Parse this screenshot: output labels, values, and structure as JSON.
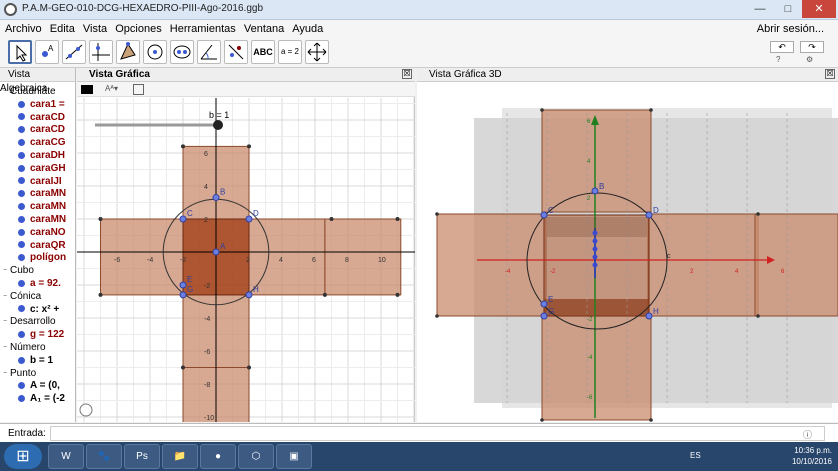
{
  "window": {
    "title": "P.A.M-GEO-010-DCG-HEXAEDRO-PIII-Ago-2016.ggb",
    "min": "—",
    "max": "□",
    "close": "✕"
  },
  "menu": {
    "items": [
      "Archivo",
      "Edita",
      "Vista",
      "Opciones",
      "Herramientas",
      "Ventana",
      "Ayuda"
    ],
    "signin": "Abrir sesión..."
  },
  "toolbar": {
    "text_tool": "ABC",
    "slider_tool": "a = 2",
    "undo": "↶",
    "redo": "↷",
    "help": "?",
    "gear": "⚙"
  },
  "panels": {
    "algebra_title": "Vista Algebraica",
    "graphics_title": "Vista Gráfica",
    "g3d_title": "Vista Gráfica 3D",
    "close": "☒"
  },
  "algebra": {
    "items": [
      {
        "kind": "cat",
        "text": "Cuadriláte"
      },
      {
        "kind": "it",
        "text": "cara1 =",
        "color": "#8b0000"
      },
      {
        "kind": "it",
        "text": "caraCD",
        "color": "#8b0000"
      },
      {
        "kind": "it",
        "text": "caraCD",
        "color": "#8b0000"
      },
      {
        "kind": "it",
        "text": "caraCG",
        "color": "#8b0000"
      },
      {
        "kind": "it",
        "text": "caraDH",
        "color": "#8b0000"
      },
      {
        "kind": "it",
        "text": "caraGH",
        "color": "#8b0000"
      },
      {
        "kind": "it",
        "text": "caraIJI",
        "color": "#8b0000"
      },
      {
        "kind": "it",
        "text": "caraMN",
        "color": "#8b0000"
      },
      {
        "kind": "it",
        "text": "caraMN",
        "color": "#8b0000"
      },
      {
        "kind": "it",
        "text": "caraMN",
        "color": "#8b0000"
      },
      {
        "kind": "it",
        "text": "caraNO",
        "color": "#8b0000"
      },
      {
        "kind": "it",
        "text": "caraQR",
        "color": "#8b0000"
      },
      {
        "kind": "it",
        "text": "polígon",
        "color": "#8b0000"
      },
      {
        "kind": "cat",
        "text": "Cubo"
      },
      {
        "kind": "it",
        "text": "a = 92.",
        "color": "#8b0000"
      },
      {
        "kind": "cat",
        "text": "Cónica"
      },
      {
        "kind": "it",
        "text": "c: x² +",
        "color": "#000"
      },
      {
        "kind": "cat",
        "text": "Desarrollo"
      },
      {
        "kind": "it",
        "text": "g = 122",
        "color": "#8b0000"
      },
      {
        "kind": "cat",
        "text": "Número"
      },
      {
        "kind": "it",
        "text": "b = 1",
        "color": "#000"
      },
      {
        "kind": "cat",
        "text": "Punto"
      },
      {
        "kind": "it",
        "text": "A = (0,",
        "color": "#000"
      },
      {
        "kind": "it",
        "text": "A₁ = (-2",
        "color": "#000"
      }
    ]
  },
  "graphics2d": {
    "slider_label": "b = 1",
    "x_ticks": [
      -6,
      -4,
      -2,
      0,
      2,
      4,
      6,
      8,
      10
    ],
    "y_ticks": [
      6,
      4,
      2,
      -2,
      -4,
      -6,
      -8,
      -10
    ],
    "points": {
      "B": "B",
      "C": "C",
      "D": "D",
      "G": "G",
      "H": "H",
      "E": "E",
      "A": "A"
    },
    "color_fill": "#c98b6e",
    "color_center": "#a5421b"
  },
  "graphics3d": {
    "x_ticks": [
      "-4",
      "-2",
      "2",
      "4",
      "6"
    ],
    "y_ticks": [
      "6",
      "4",
      "2",
      "-2",
      "-4",
      "-6"
    ],
    "points": {
      "B": "B",
      "C": "C",
      "D": "D",
      "G": "G",
      "H": "H",
      "E": "E",
      "c": "c"
    }
  },
  "inputbar": {
    "label": "Entrada:",
    "help": "ⓘ"
  },
  "taskbar": {
    "start": "⊞",
    "lang": "ES",
    "time": "10:36 p.m.",
    "date": "10/10/2016",
    "apps": [
      "W",
      "🐾",
      "Ps",
      "📁",
      "●",
      "⬡",
      "▣"
    ]
  }
}
